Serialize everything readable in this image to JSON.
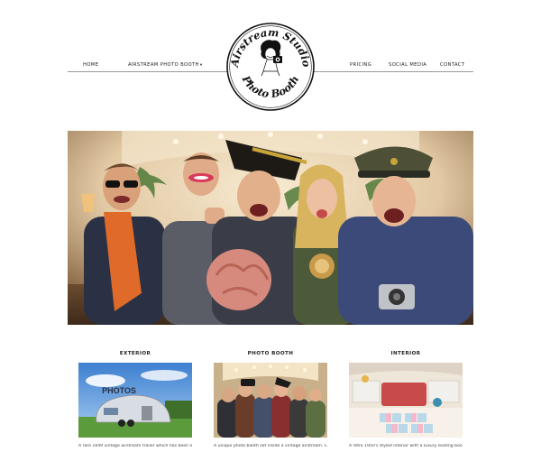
{
  "nav": {
    "left": [
      {
        "label": "HOME"
      },
      {
        "label": "AIRSTREAM PHOTO BOOTH",
        "caret": "▾"
      }
    ],
    "right": [
      {
        "label": "PRICING"
      },
      {
        "label": "SOCIAL MEDIA"
      },
      {
        "label": "CONTACT"
      }
    ]
  },
  "logo": {
    "line1": "Airstream Studio",
    "line2": "Photo Booth"
  },
  "hero": {
    "icon": "group-photo-booth-party"
  },
  "cards": [
    {
      "title": "EXTERIOR",
      "text": "A rare 1949 vintage airstream trailer which has been lovingly",
      "icon": "airstream-trailer-exterior",
      "sign": "PHOTOS"
    },
    {
      "title": "PHOTO BOOTH",
      "text": "A unique photo booth set inside a vintage airstream. Capture",
      "icon": "photo-booth-group"
    },
    {
      "title": "INTERIOR",
      "text": "A retro 1950's styled interior with a luxury seating booth,",
      "icon": "retro-interior"
    }
  ],
  "colors": {
    "nav_rule": "#9a9a9a",
    "text": "#222222"
  }
}
